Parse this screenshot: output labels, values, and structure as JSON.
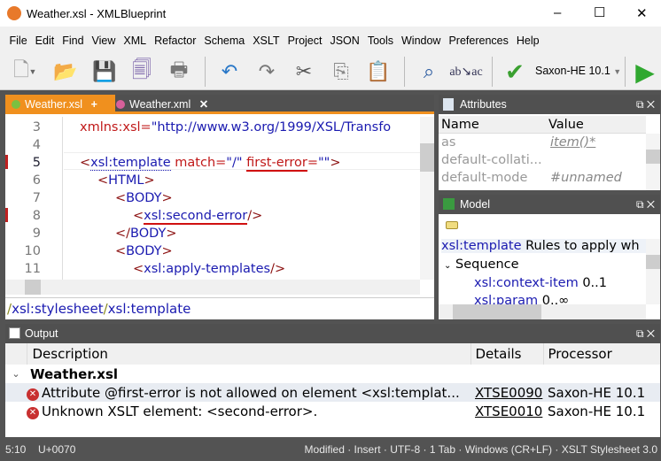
{
  "window": {
    "title": "Weather.xsl - XMLBlueprint",
    "minimize": "–",
    "maximize": "☐",
    "close": "✕"
  },
  "menu": [
    "File",
    "Edit",
    "Find",
    "View",
    "XML",
    "Refactor",
    "Schema",
    "XSLT",
    "Project",
    "JSON",
    "Tools",
    "Window",
    "Preferences",
    "Help"
  ],
  "toolbar": {
    "processor": "Saxon-HE 10.1"
  },
  "editor": {
    "tabs": [
      {
        "label": "Weather.xsl",
        "action": "+"
      },
      {
        "label": "Weather.xml",
        "action": "✕"
      }
    ],
    "line_numbers": [
      "3",
      "4",
      "5",
      "6",
      "7",
      "8",
      "9",
      "10",
      "11"
    ],
    "lines": {
      "l3a": "xmlns:xsl=",
      "l3b": "\"http://www.w3.org/1999/XSL/Transfo",
      "l5a": "<",
      "l5b": "xsl:template",
      "l5c": " match=",
      "l5d": "\"/\"",
      "l5e": " ",
      "l5f": "first-error",
      "l5g": "=",
      "l5h": "\"\"",
      "l5i": ">",
      "l6a": "<",
      "l6b": "HTML",
      "l6c": ">",
      "l7a": "<",
      "l7b": "BODY",
      "l7c": ">",
      "l8a": "<",
      "l8b": "xsl:second-error",
      "l8c": "/>",
      "l9a": "</",
      "l9b": "BODY",
      "l9c": ">",
      "l10a": "<",
      "l10b": "BODY",
      "l10c": ">",
      "l11a": "<",
      "l11b": "xsl:apply-templates",
      "l11c": "/>"
    },
    "breadcrumb": {
      "sep1": "/",
      "p1": "xsl:stylesheet",
      "sep2": "/",
      "p2": "xsl:template"
    }
  },
  "attributes": {
    "title": "Attributes",
    "headers": [
      "Name",
      "Value"
    ],
    "rows": [
      {
        "name": "as",
        "value": "item()*"
      },
      {
        "name": "default-collati...",
        "value": ""
      },
      {
        "name": "default-mode",
        "value": "#unnamed"
      }
    ]
  },
  "model": {
    "title": "Model",
    "element": "xsl:template",
    "description": "Rules to apply wh",
    "group": "Sequence",
    "items": [
      {
        "name": "xsl:context-item",
        "occ": "0..1"
      },
      {
        "name": "xsl:param",
        "occ": "0..∞"
      }
    ]
  },
  "output": {
    "title": "Output",
    "headers": [
      "Description",
      "Details",
      "Processor"
    ],
    "group": "Weather.xsl",
    "rows": [
      {
        "desc": "Attribute @first-error is not allowed on element <xsl:templat...",
        "code": "XTSE0090",
        "proc": "Saxon-HE 10.1"
      },
      {
        "desc": "Unknown XSLT element: <second-error>.",
        "code": "XTSE0010",
        "proc": "Saxon-HE 10.1"
      }
    ]
  },
  "status": {
    "position": "5:10",
    "char": "U+0070",
    "right": "Modified · Insert · UTF-8 · 1 Tab · Windows (CR+LF) · XSLT Stylesheet 3.0"
  }
}
